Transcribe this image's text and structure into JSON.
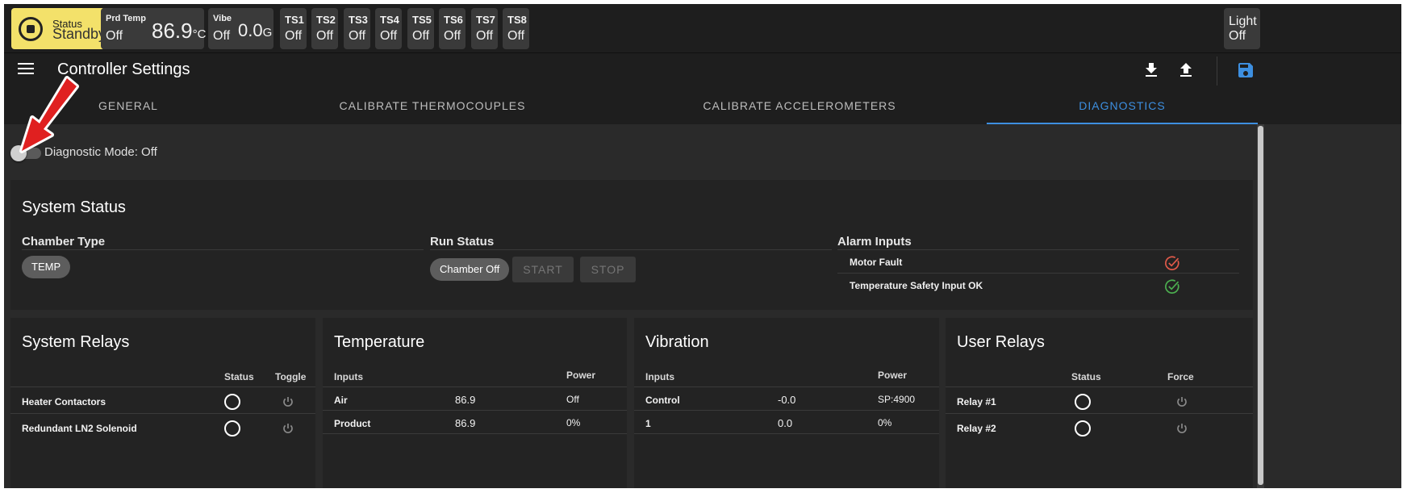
{
  "topbar": {
    "status": {
      "label": "Status",
      "value": "Standby"
    },
    "prd_temp": {
      "label": "Prd Temp",
      "state": "Off",
      "value": "86.9",
      "unit": "°C"
    },
    "vibe": {
      "label": "Vibe",
      "state": "Off",
      "value": "0.0",
      "unit": "G"
    },
    "ts": [
      {
        "label": "TS1",
        "value": "Off"
      },
      {
        "label": "TS2",
        "value": "Off"
      },
      {
        "label": "TS3",
        "value": "Off"
      },
      {
        "label": "TS4",
        "value": "Off"
      },
      {
        "label": "TS5",
        "value": "Off"
      },
      {
        "label": "TS6",
        "value": "Off"
      },
      {
        "label": "TS7",
        "value": "Off"
      },
      {
        "label": "TS8",
        "value": "Off"
      }
    ],
    "light": {
      "label": "Light",
      "value": "Off"
    }
  },
  "header": {
    "title": "Controller Settings"
  },
  "tabs": [
    {
      "label": "GENERAL"
    },
    {
      "label": "CALIBRATE THERMOCOUPLES"
    },
    {
      "label": "CALIBRATE ACCELEROMETERS"
    },
    {
      "label": "DIAGNOSTICS"
    }
  ],
  "diagnostic": {
    "label": "Diagnostic Mode: Off"
  },
  "system_status": {
    "title": "System Status",
    "chamber_type": {
      "title": "Chamber Type",
      "value": "TEMP"
    },
    "run_status": {
      "title": "Run Status",
      "state": "Chamber Off",
      "start": "START",
      "stop": "STOP"
    },
    "alarm_inputs": {
      "title": "Alarm Inputs",
      "rows": [
        {
          "label": "Motor Fault",
          "status_color": "#e25a4a"
        },
        {
          "label": "Temperature Safety Input OK",
          "status_color": "#4caf50"
        }
      ]
    }
  },
  "system_relays": {
    "title": "System Relays",
    "col_status": "Status",
    "col_toggle": "Toggle",
    "rows": [
      {
        "label": "Heater Contactors"
      },
      {
        "label": "Redundant LN2 Solenoid"
      }
    ]
  },
  "temperature": {
    "title": "Temperature",
    "col_inputs": "Inputs",
    "col_power": "Power",
    "rows": [
      {
        "label": "Air",
        "value": "86.9",
        "power": "Off"
      },
      {
        "label": "Product",
        "value": "86.9",
        "power": "0%"
      }
    ]
  },
  "vibration": {
    "title": "Vibration",
    "col_inputs": "Inputs",
    "col_power": "Power",
    "rows": [
      {
        "label": "Control",
        "value": "-0.0",
        "power": "SP:4900"
      },
      {
        "label": "1",
        "value": "0.0",
        "power": "0%"
      }
    ]
  },
  "user_relays": {
    "title": "User Relays",
    "col_status": "Status",
    "col_force": "Force",
    "rows": [
      {
        "label": "Relay #1"
      },
      {
        "label": "Relay #2"
      }
    ]
  },
  "colors": {
    "accent": "#3d8fe0",
    "status_bg": "#f3e16a",
    "arrow": "#e02020"
  }
}
